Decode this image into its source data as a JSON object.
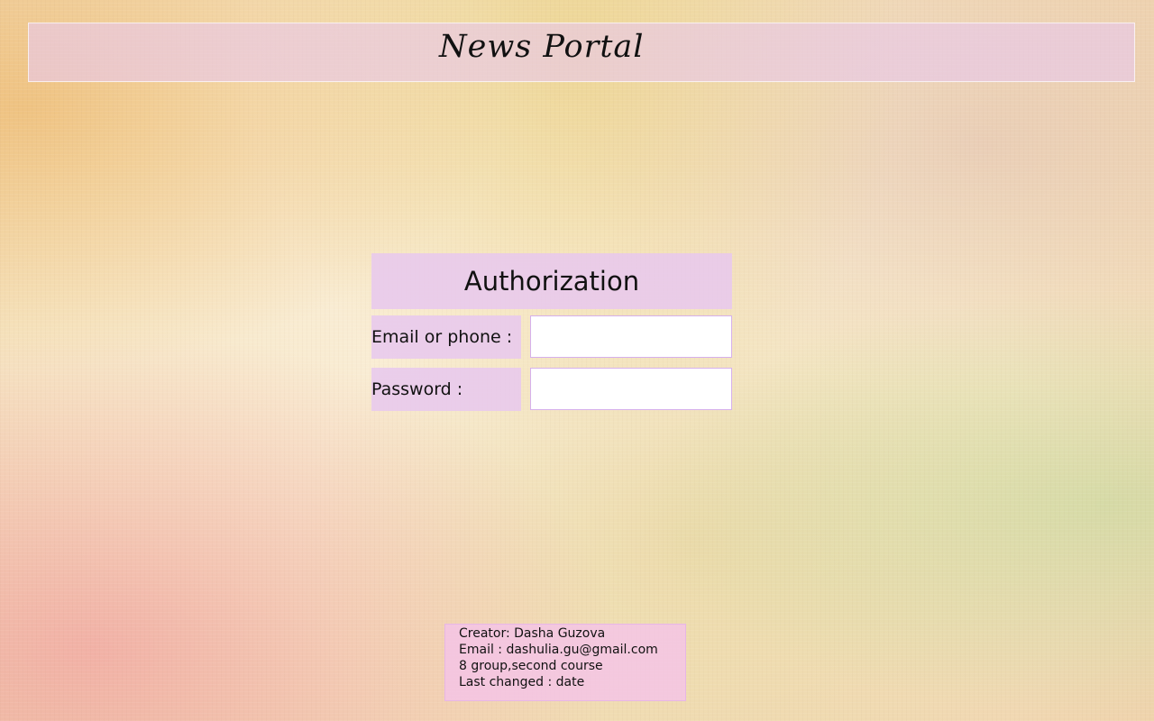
{
  "header": {
    "title": "News Portal"
  },
  "auth": {
    "title": "Authorization",
    "email_label": "Email or phone :",
    "email_value": "",
    "password_label": "Password :",
    "password_value": ""
  },
  "footer": {
    "creator": "Creator: Dasha Guzova",
    "email": "Email : dashulia.gu@gmail.com",
    "group": "8 group,second course",
    "last_changed": "Last changed : date"
  },
  "colors": {
    "panel_lilac": "#e8c8ee",
    "footer_pink": "#f5c3eb",
    "input_border": "#d6b0ec"
  }
}
